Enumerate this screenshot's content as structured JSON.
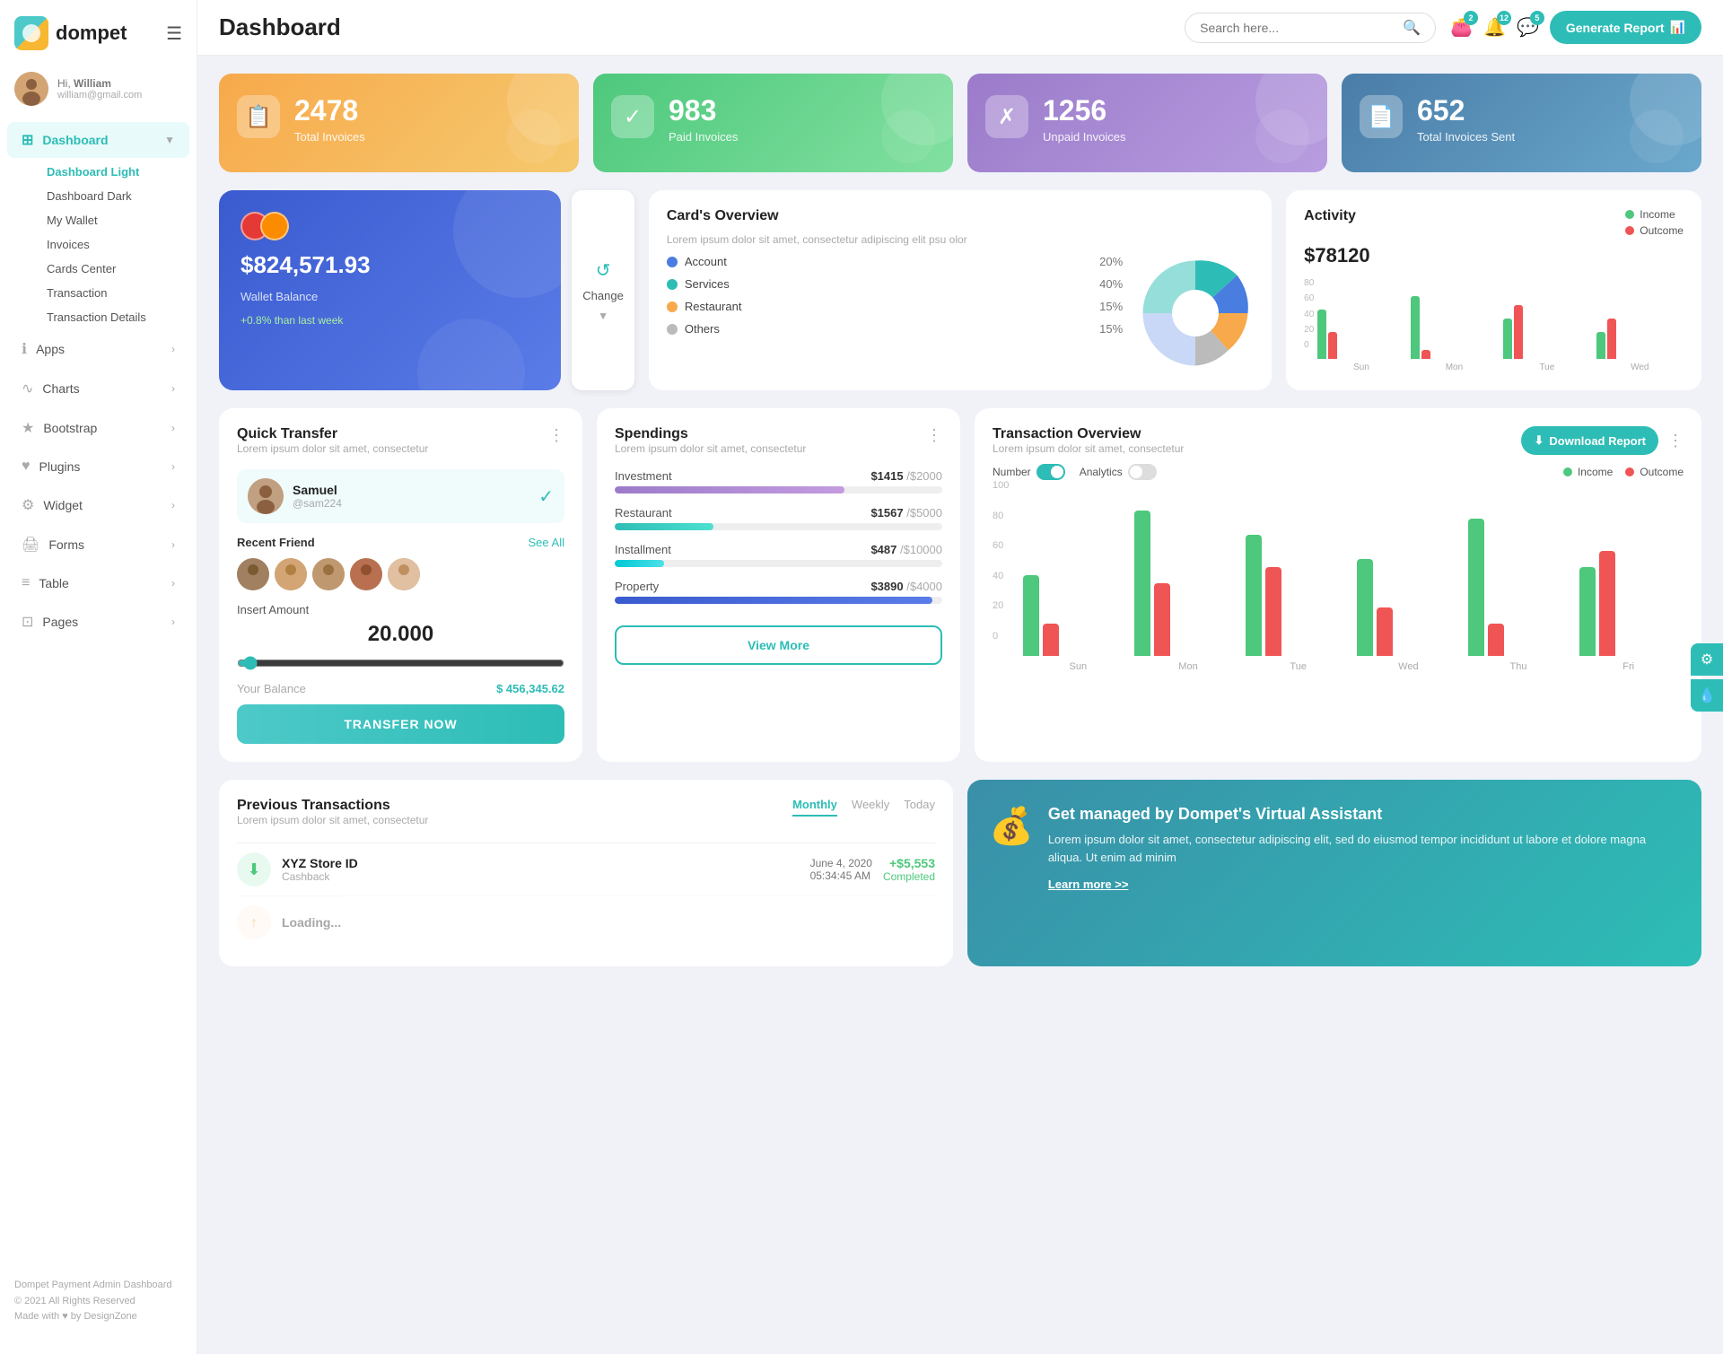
{
  "app": {
    "name": "dompet",
    "title": "Dashboard"
  },
  "header": {
    "search_placeholder": "Search here...",
    "generate_btn": "Generate Report",
    "badges": {
      "wallet": "2",
      "bell": "12",
      "chat": "5"
    }
  },
  "user": {
    "greeting": "Hi,",
    "name": "William",
    "email": "william@gmail.com"
  },
  "sidebar": {
    "nav_items": [
      {
        "id": "dashboard",
        "label": "Dashboard",
        "icon": "⊞",
        "active": true,
        "has_arrow": true
      },
      {
        "id": "apps",
        "label": "Apps",
        "icon": "ℹ",
        "has_arrow": true
      },
      {
        "id": "charts",
        "label": "Charts",
        "icon": "∿",
        "has_arrow": true
      },
      {
        "id": "bootstrap",
        "label": "Bootstrap",
        "icon": "★",
        "has_arrow": true
      },
      {
        "id": "plugins",
        "label": "Plugins",
        "icon": "♥",
        "has_arrow": true
      },
      {
        "id": "widget",
        "label": "Widget",
        "icon": "⚙",
        "has_arrow": true
      },
      {
        "id": "forms",
        "label": "Forms",
        "icon": "🖨",
        "has_arrow": true
      },
      {
        "id": "table",
        "label": "Table",
        "icon": "≡",
        "has_arrow": true
      },
      {
        "id": "pages",
        "label": "Pages",
        "icon": "⊡",
        "has_arrow": true
      }
    ],
    "sub_nav": [
      {
        "label": "Dashboard Light",
        "active": true
      },
      {
        "label": "Dashboard Dark",
        "active": false
      },
      {
        "label": "My Wallet",
        "active": false
      },
      {
        "label": "Invoices",
        "active": false
      },
      {
        "label": "Cards Center",
        "active": false
      },
      {
        "label": "Transaction",
        "active": false
      },
      {
        "label": "Transaction Details",
        "active": false
      }
    ],
    "footer": {
      "brand": "Dompet Payment Admin Dashboard",
      "copyright": "© 2021 All Rights Reserved",
      "made_by": "Made with ♥ by DesignZone"
    }
  },
  "stat_cards": [
    {
      "id": "total-invoices",
      "value": "2478",
      "label": "Total Invoices",
      "color": "orange",
      "icon": "📋"
    },
    {
      "id": "paid-invoices",
      "value": "983",
      "label": "Paid Invoices",
      "color": "green",
      "icon": "✓"
    },
    {
      "id": "unpaid-invoices",
      "value": "1256",
      "label": "Unpaid Invoices",
      "color": "purple",
      "icon": "✗"
    },
    {
      "id": "total-sent",
      "value": "652",
      "label": "Total Invoices Sent",
      "color": "teal",
      "icon": "📄"
    }
  ],
  "wallet": {
    "amount": "$824,571.93",
    "label": "Wallet Balance",
    "change": "+0.8% than last week"
  },
  "cards_overview": {
    "title": "Card's Overview",
    "subtitle": "Lorem ipsum dolor sit amet, consectetur adipiscing elit psu olor",
    "items": [
      {
        "name": "Account",
        "pct": "20%",
        "color": "blue"
      },
      {
        "name": "Services",
        "pct": "40%",
        "color": "teal"
      },
      {
        "name": "Restaurant",
        "pct": "15%",
        "color": "orange"
      },
      {
        "name": "Others",
        "pct": "15%",
        "color": "gray"
      }
    ],
    "pie_data": [
      {
        "label": "Account",
        "value": 20,
        "color": "#4a7de0"
      },
      {
        "label": "Services",
        "value": 40,
        "color": "#2dbdb6"
      },
      {
        "label": "Restaurant",
        "value": 15,
        "color": "#f7a94b"
      },
      {
        "label": "Others",
        "value": 15,
        "color": "#bbb"
      }
    ]
  },
  "activity": {
    "title": "Activity",
    "amount": "$78120",
    "income_label": "Income",
    "outcome_label": "Outcome",
    "bars": [
      {
        "day": "Sun",
        "income": 55,
        "outcome": 30
      },
      {
        "day": "Mon",
        "income": 70,
        "outcome": 10
      },
      {
        "day": "Tue",
        "income": 45,
        "outcome": 60
      },
      {
        "day": "Wed",
        "income": 30,
        "outcome": 45
      }
    ],
    "y_labels": [
      "0",
      "20",
      "40",
      "60",
      "80"
    ]
  },
  "quick_transfer": {
    "title": "Quick Transfer",
    "subtitle": "Lorem ipsum dolor sit amet, consectetur",
    "person": {
      "name": "Samuel",
      "handle": "@sam224"
    },
    "recent_label": "Recent Friend",
    "see_all": "See All",
    "insert_label": "Insert Amount",
    "amount": "20.000",
    "balance_label": "Your Balance",
    "balance_value": "$ 456,345.62",
    "btn_label": "TRANSFER NOW"
  },
  "spendings": {
    "title": "Spendings",
    "subtitle": "Lorem ipsum dolor sit amet, consectetur",
    "items": [
      {
        "name": "Investment",
        "current": "$1415",
        "total": "/$2000",
        "pct": 70,
        "color": "purple"
      },
      {
        "name": "Restaurant",
        "current": "$1567",
        "total": "/$5000",
        "pct": 30,
        "color": "teal"
      },
      {
        "name": "Installment",
        "current": "$487",
        "total": "/$10000",
        "pct": 15,
        "color": "cyan"
      },
      {
        "name": "Property",
        "current": "$3890",
        "total": "/$4000",
        "pct": 97,
        "color": "darkblue"
      }
    ],
    "btn_label": "View More"
  },
  "transaction_overview": {
    "title": "Transaction Overview",
    "subtitle": "Lorem ipsum dolor sit amet, consectetur",
    "btn_download": "Download Report",
    "toggle_number": "Number",
    "toggle_analytics": "Analytics",
    "income_label": "Income",
    "outcome_label": "Outcome",
    "bars": [
      {
        "day": "Sun",
        "income": 50,
        "outcome": 20
      },
      {
        "day": "Mon",
        "income": 90,
        "outcome": 45
      },
      {
        "day": "Tue",
        "income": 75,
        "outcome": 55
      },
      {
        "day": "Wed",
        "income": 60,
        "outcome": 30
      },
      {
        "day": "Thu",
        "income": 85,
        "outcome": 20
      },
      {
        "day": "Fri",
        "income": 55,
        "outcome": 65
      }
    ],
    "y_labels": [
      "0",
      "20",
      "40",
      "60",
      "80",
      "100"
    ]
  },
  "prev_transactions": {
    "title": "Previous Transactions",
    "subtitle": "Lorem ipsum dolor sit amet, consectetur",
    "tabs": [
      "Monthly",
      "Weekly",
      "Today"
    ],
    "active_tab": "Monthly",
    "items": [
      {
        "name": "XYZ Store ID",
        "type": "Cashback",
        "date": "June 4, 2020",
        "time": "05:34:45 AM",
        "amount": "+$5,553",
        "status": "Completed",
        "icon_type": "green"
      }
    ]
  },
  "virtual_assistant": {
    "title": "Get managed by Dompet's Virtual Assistant",
    "text": "Lorem ipsum dolor sit amet, consectetur adipiscing elit, sed do eiusmod tempor incididunt ut labore et dolore magna aliqua. Ut enim ad minim",
    "link": "Learn more >>"
  }
}
